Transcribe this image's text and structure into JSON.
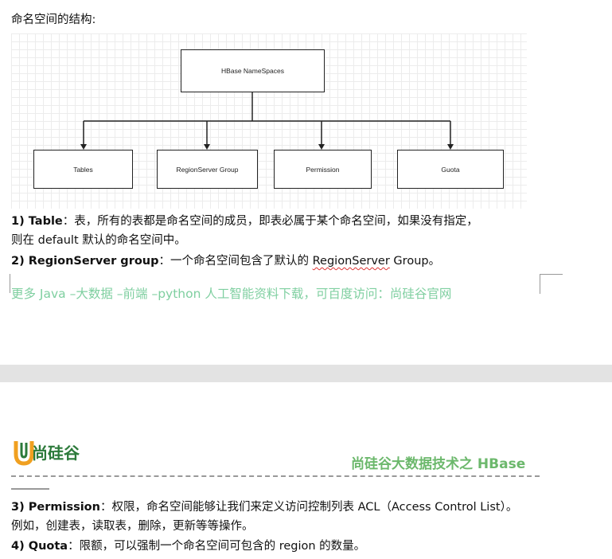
{
  "top_cut_text": "",
  "intro": "命名空间的结构:",
  "diagram": {
    "root": "HBase NameSpaces",
    "children": [
      "Tables",
      "RegionServer Group",
      "Permission",
      "Guota"
    ]
  },
  "para1": {
    "num": "1) Table",
    "text": "：表，所有的表都是命名空间的成员，即表必属于某个命名空间，如果没有指定，",
    "text2": "则在 default 默认的命名空间中。"
  },
  "para2": {
    "num": "2) RegionServer group",
    "text_a": "：一个命名空间包含了默认的 ",
    "link": "RegionServer",
    "text_b": " Group。"
  },
  "watermark": "更多 Java –大数据 –前端 –python 人工智能资料下载，可百度访问：尚硅谷官网",
  "header": {
    "logo_text": "尚硅谷",
    "title": "尚硅谷大数据技术之 HBase"
  },
  "para3": {
    "num": "3) Permission",
    "text": "：权限，命名空间能够让我们来定义访问控制列表 ACL（Access Control List）。",
    "text2": "例如，创建表，读取表，删除，更新等等操作。"
  },
  "para4": {
    "num": "4) Quota",
    "text": "：限额，可以强制一个命名空间可包含的 region 的数量。"
  },
  "colors": {
    "watermark": "#7fcfa0",
    "brand_green": "#6cb86c",
    "logo_green": "#2c7a3a"
  }
}
